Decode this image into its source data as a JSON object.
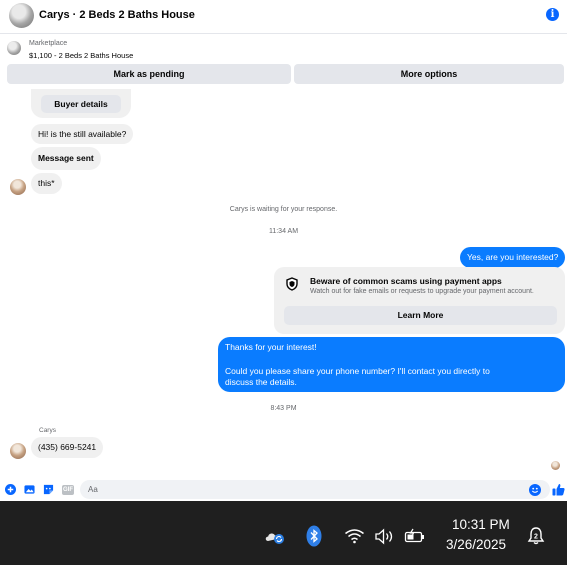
{
  "header": {
    "title": "Carys · 2 Beds 2 Baths House",
    "info_label": "i"
  },
  "listing": {
    "category": "Marketplace",
    "price_title": "$1,100 - 2 Beds 2 Baths House",
    "mark_pending_label": "Mark as pending",
    "more_options_label": "More options"
  },
  "chat": {
    "buyer_details_label": "Buyer details",
    "messages": [
      {
        "from": "them",
        "text": "Hi! is the still available?"
      },
      {
        "from": "them",
        "text": "Message sent"
      },
      {
        "from": "them",
        "text": "this*"
      },
      {
        "from": "system",
        "text": "Carys is waiting for your response."
      },
      {
        "from": "time",
        "text": "11:34 AM"
      },
      {
        "from": "me",
        "text": "Yes, are you interested?"
      },
      {
        "from": "me",
        "text": "Thanks for your interest!"
      },
      {
        "from": "me",
        "text": "Could you please share your phone number? I'll contact you directly to discuss the details."
      },
      {
        "from": "time",
        "text": "8:43 PM"
      },
      {
        "from": "them",
        "sender": "Carys",
        "text": "(435) 669-5241"
      }
    ],
    "scam_notice": {
      "title": "Beware of common scams using payment apps",
      "subtitle": "Watch out for fake emails or requests to upgrade your payment account.",
      "button_label": "Learn More"
    }
  },
  "composer": {
    "placeholder": "Aa",
    "icons": [
      "plus-icon",
      "photo-icon",
      "sticker-icon",
      "gif-icon",
      "emoji-icon",
      "thumbs-up-icon"
    ],
    "gif_label": "GIF"
  },
  "taskbar": {
    "time": "10:31 PM",
    "date": "3/26/2025",
    "icons": [
      "weather-sync-icon",
      "bluetooth-icon",
      "wifi-icon",
      "volume-icon",
      "battery-icon",
      "notification-bell-icon"
    ],
    "notification_badge": "2"
  },
  "colors": {
    "accent": "#0866ff",
    "outgoing_bubble": "#0a7cff",
    "incoming_bubble": "#f0f0f0",
    "taskbar": "#1f1f1f"
  }
}
